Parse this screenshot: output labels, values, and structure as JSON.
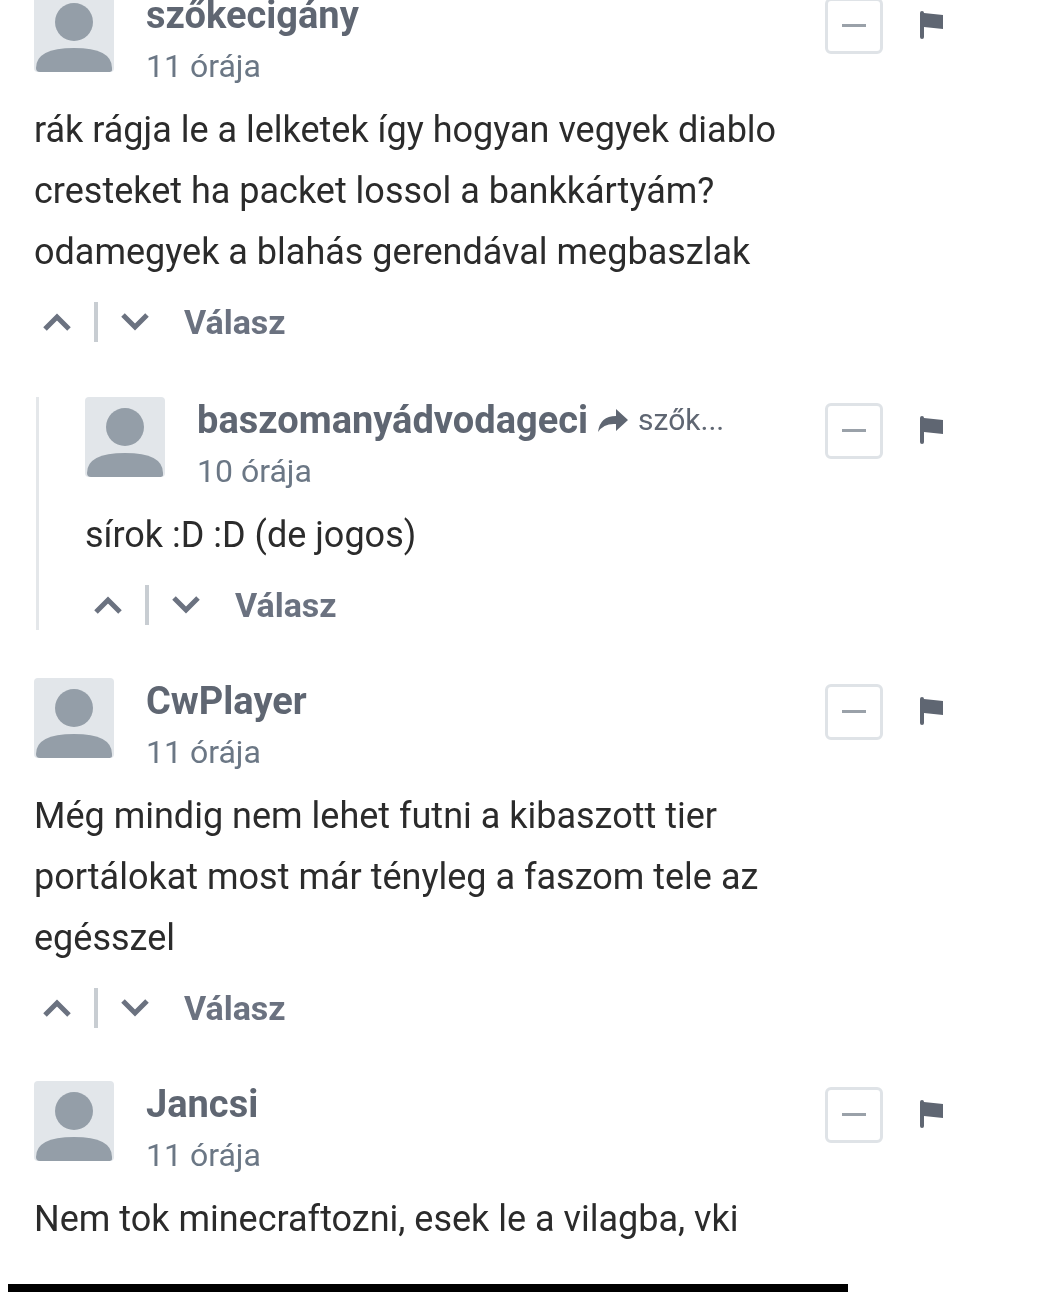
{
  "comments": [
    {
      "author": "szőkecigány",
      "time": "11 órája",
      "body": [
        "rák rágja le a lelketek így hogyan vegyek diablo",
        "cresteket ha packet lossol a bankkártyám?",
        "odamegyek a blahás gerendával megbaszlak"
      ],
      "reply_label": "Válasz",
      "children": [
        {
          "author": "baszomanyádvodageci",
          "reply_to": "szők...",
          "time": "10 órája",
          "body": [
            "sírok :D :D (de jogos)"
          ],
          "reply_label": "Válasz"
        }
      ]
    },
    {
      "author": "CwPlayer",
      "time": "11 órája",
      "body": [
        "Még mindig nem lehet futni a kibaszott tier",
        "portálokat most már tényleg a faszom tele az",
        "egésszel"
      ],
      "reply_label": "Válasz"
    },
    {
      "author": "Jancsi",
      "time": "11 órája",
      "body": [
        "Nem tok minecraftozni, esek le a vilagba, vki"
      ]
    }
  ]
}
